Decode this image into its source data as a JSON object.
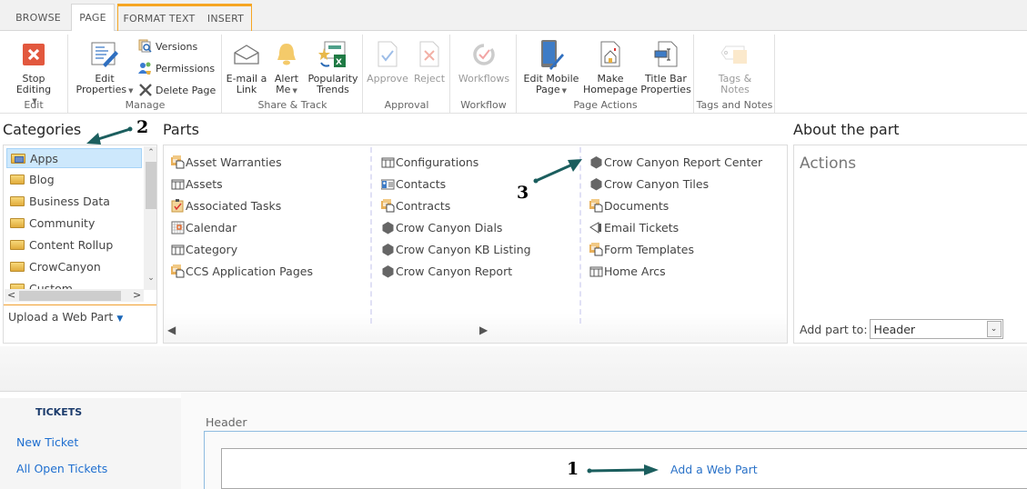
{
  "tabs": [
    {
      "label": "BROWSE",
      "active": false
    },
    {
      "label": "PAGE",
      "active": true
    },
    {
      "label": "FORMAT TEXT",
      "active": false,
      "contextual": true
    },
    {
      "label": "INSERT",
      "active": false,
      "contextual": true
    }
  ],
  "ribbon": {
    "edit": {
      "label": "Edit",
      "stop_editing": "Stop Editing"
    },
    "manage": {
      "label": "Manage",
      "edit_properties_1": "Edit",
      "edit_properties_2": "Properties",
      "versions": "Versions",
      "permissions": "Permissions",
      "delete_page": "Delete Page"
    },
    "share": {
      "label": "Share & Track",
      "email_1": "E-mail a",
      "email_2": "Link",
      "alert_1": "Alert",
      "alert_2": "Me",
      "popularity_1": "Popularity",
      "popularity_2": "Trends"
    },
    "approval": {
      "label": "Approval",
      "approve": "Approve",
      "reject": "Reject"
    },
    "workflow": {
      "label": "Workflow",
      "workflows": "Workflows"
    },
    "page_actions": {
      "label": "Page Actions",
      "mobile_1": "Edit Mobile",
      "mobile_2": "Page",
      "homepage_1": "Make",
      "homepage_2": "Homepage",
      "titlebar_1": "Title Bar",
      "titlebar_2": "Properties"
    },
    "tags": {
      "label": "Tags and Notes",
      "tags_1": "Tags &",
      "tags_2": "Notes"
    }
  },
  "categories": {
    "title": "Categories",
    "items": [
      "Apps",
      "Blog",
      "Business Data",
      "Community",
      "Content Rollup",
      "CrowCanyon",
      "Custom"
    ],
    "selected": "Apps",
    "upload": "Upload a Web Part"
  },
  "parts": {
    "title": "Parts",
    "columns": [
      [
        {
          "label": "Asset Warranties",
          "icon": "library-icon"
        },
        {
          "label": "Assets",
          "icon": "list-icon"
        },
        {
          "label": "Associated Tasks",
          "icon": "tasks-icon"
        },
        {
          "label": "Calendar",
          "icon": "calendar-icon"
        },
        {
          "label": "Category",
          "icon": "list-icon"
        },
        {
          "label": "CCS Application Pages",
          "icon": "library-icon"
        }
      ],
      [
        {
          "label": "Configurations",
          "icon": "list-icon"
        },
        {
          "label": "Contacts",
          "icon": "contacts-icon"
        },
        {
          "label": "Contracts",
          "icon": "library-icon"
        },
        {
          "label": "Crow Canyon Dials",
          "icon": "hexagon-icon"
        },
        {
          "label": "Crow Canyon KB Listing",
          "icon": "hexagon-icon"
        },
        {
          "label": "Crow Canyon Report",
          "icon": "hexagon-icon"
        }
      ],
      [
        {
          "label": "Crow Canyon Report Center",
          "icon": "hexagon-icon"
        },
        {
          "label": "Crow Canyon Tiles",
          "icon": "hexagon-icon"
        },
        {
          "label": "Documents",
          "icon": "library-icon"
        },
        {
          "label": "Email Tickets",
          "icon": "announcement-icon"
        },
        {
          "label": "Form Templates",
          "icon": "library-icon"
        },
        {
          "label": "Home Arcs",
          "icon": "list-icon"
        }
      ]
    ]
  },
  "about": {
    "title": "About the part",
    "heading": "Actions",
    "add_part_label": "Add part to:",
    "add_part_value": "Header"
  },
  "leftnav": {
    "heading": "TICKETS",
    "links": [
      "New Ticket",
      "All Open Tickets"
    ]
  },
  "zone": {
    "label": "Header",
    "add_web_part": "Add a Web Part"
  },
  "annotations": [
    "1",
    "2",
    "3"
  ],
  "colors": {
    "accent_orange": "#f6a623",
    "link_blue": "#1f6fd0",
    "annotation_arrow": "#1b5e5e",
    "selected_bg": "#cde8fc",
    "stop_editing_red": "#e2583e"
  }
}
